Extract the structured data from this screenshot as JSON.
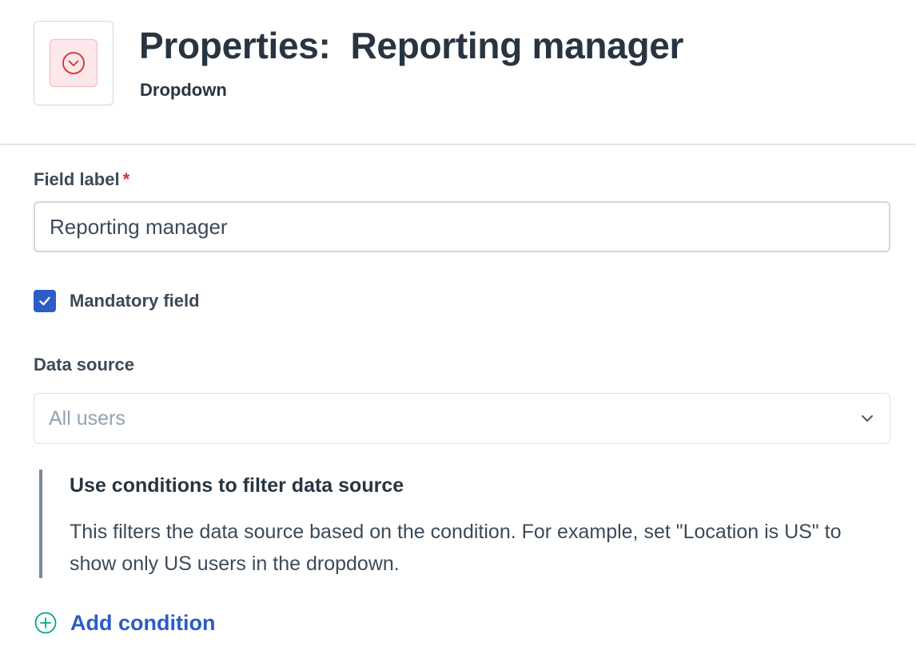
{
  "header": {
    "title": "Properties:  Reporting manager",
    "subtitle": "Dropdown",
    "icon": "dropdown-icon"
  },
  "form": {
    "field_label": {
      "label": "Field label",
      "required_marker": "*",
      "value": "Reporting manager"
    },
    "mandatory": {
      "label": "Mandatory field",
      "checked": true
    },
    "data_source": {
      "label": "Data source",
      "placeholder": "All users"
    },
    "conditions_info": {
      "title": "Use conditions to filter data source",
      "description": "This filters the data source based on the condition. For example, set \"Location is US\" to show only US users in the dropdown."
    },
    "add_condition_label": "Add condition"
  },
  "colors": {
    "accent": "#2c5cc5",
    "required": "#d72d30",
    "icon_bg": "#fde7ea",
    "add_icon": "#00a886"
  }
}
